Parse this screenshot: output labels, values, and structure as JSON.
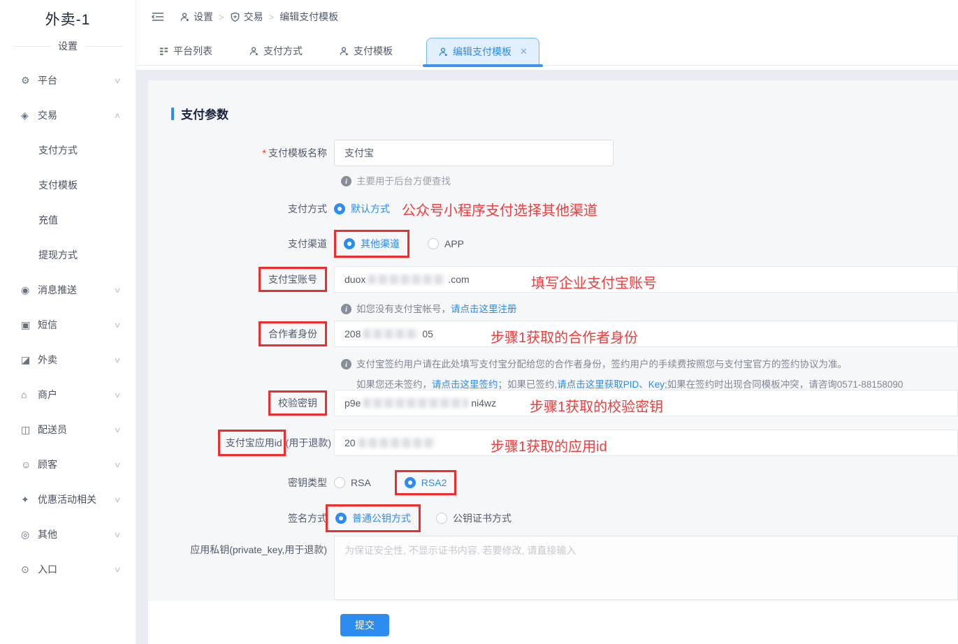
{
  "colors": {
    "accent_blue": "#2d8cf0",
    "annotation_red": "#f33b3b",
    "box_red": "#f12c2c",
    "panel_bg": "#f5f7f9"
  },
  "sidebar": {
    "title": "外卖-1",
    "section_label": "设置",
    "items": [
      {
        "name": "platform",
        "icon": "gear",
        "label": "平台",
        "chevron": "down"
      },
      {
        "name": "trade",
        "icon": "trade",
        "label": "交易",
        "chevron": "up",
        "children": [
          "支付方式",
          "支付模板",
          "充值",
          "提现方式"
        ]
      },
      {
        "name": "message-push",
        "icon": "message",
        "label": "消息推送",
        "chevron": "down"
      },
      {
        "name": "sms",
        "icon": "sms",
        "label": "短信",
        "chevron": "down"
      },
      {
        "name": "takeout",
        "icon": "takeout",
        "label": "外卖",
        "chevron": "down"
      },
      {
        "name": "merchant",
        "icon": "merchant",
        "label": "商户",
        "chevron": "down"
      },
      {
        "name": "courier",
        "icon": "courier",
        "label": "配送员",
        "chevron": "down"
      },
      {
        "name": "customer",
        "icon": "customer",
        "label": "顾客",
        "chevron": "down"
      },
      {
        "name": "promotion",
        "icon": "gift",
        "label": "优惠活动相关",
        "chevron": "down"
      },
      {
        "name": "other",
        "icon": "other",
        "label": "其他",
        "chevron": "down"
      },
      {
        "name": "entrance",
        "icon": "entrance",
        "label": "入口",
        "chevron": "down"
      }
    ]
  },
  "breadcrumb": [
    {
      "icon": "person",
      "label": "设置"
    },
    {
      "icon": "shield",
      "label": "交易"
    },
    {
      "icon": "",
      "label": "编辑支付模板"
    }
  ],
  "tabs": [
    {
      "icon": "list",
      "label": "平台列表",
      "active": false,
      "closable": false
    },
    {
      "icon": "person",
      "label": "支付方式",
      "active": false,
      "closable": false
    },
    {
      "icon": "person",
      "label": "支付模板",
      "active": false,
      "closable": false
    },
    {
      "icon": "person",
      "label": "编辑支付模板",
      "active": true,
      "closable": true
    }
  ],
  "form": {
    "section_title": "支付参数",
    "template_name": {
      "label": "支付模板名称",
      "value": "支付宝",
      "hint": "主要用于后台方便查找"
    },
    "pay_method": {
      "label": "支付方式",
      "selected_option": "默认方式",
      "annotation": "公众号小程序支付选择其他渠道"
    },
    "pay_channel": {
      "label": "支付渠道",
      "option_selected": "其他渠道",
      "option_other": "APP"
    },
    "alipay_account": {
      "label": "支付宝账号",
      "value_prefix": "duox",
      "value_suffix": ".com",
      "annotation": "填写企业支付宝账号",
      "hint_text": "如您没有支付宝帐号，",
      "hint_link": "请点击这里注册"
    },
    "partner_id": {
      "label": "合作者身份",
      "value_prefix": "208",
      "value_suffix": "05",
      "annotation": "步骤1获取的合作者身份",
      "hint_line1": "支付宝签约用户请在此处填写支付宝分配给您的合作者身份，签约用户的手续费按照您与支付宝官方的签约协议为准。",
      "hint_line2_p1": "如果您还未签约，",
      "hint_line2_link1": "请点击这里签约",
      "hint_line2_p2": "；如果已签约,",
      "hint_line2_link2": "请点击这里获取PID、Key",
      "hint_line2_p3": ";如果在签约时出现合同模板冲突，请咨询0571-88158090"
    },
    "check_key": {
      "label": "校验密钥",
      "value_prefix": "p9e",
      "value_suffix": "ni4wz",
      "annotation": "步骤1获取的校验密钥"
    },
    "app_id": {
      "label_boxed": "支付宝应用id",
      "label_rest": "(用于退款)",
      "value_prefix": "20",
      "annotation": "步骤1获取的应用id"
    },
    "key_type": {
      "label": "密钥类型",
      "option_rsa": "RSA",
      "option_rsa2": "RSA2"
    },
    "sign_type": {
      "label": "签名方式",
      "option_public": "普通公钥方式",
      "option_cert": "公钥证书方式"
    },
    "private_key": {
      "label": "应用私钥(private_key,用于退款)",
      "placeholder": "为保证安全性, 不显示证书内容. 若要修改, 请直接输入"
    },
    "submit_label": "提交"
  }
}
